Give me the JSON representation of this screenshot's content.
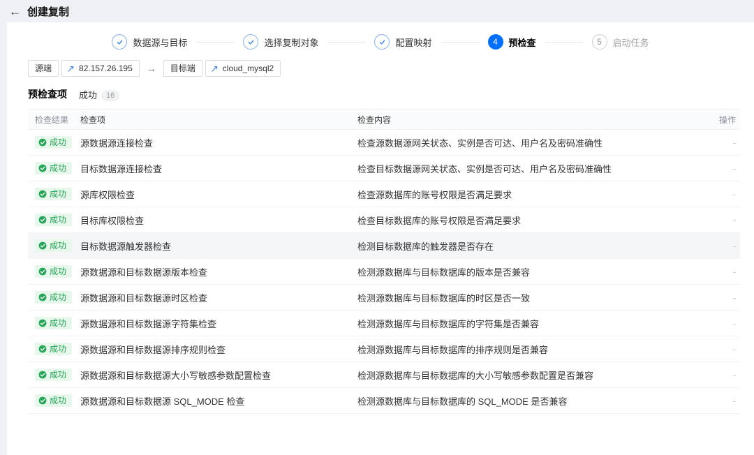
{
  "page": {
    "back_glyph": "←",
    "title": "创建复制"
  },
  "stepper": {
    "steps": [
      {
        "num": "1",
        "label": "数据源与目标",
        "state": "done"
      },
      {
        "num": "2",
        "label": "选择复制对象",
        "state": "done"
      },
      {
        "num": "3",
        "label": "配置映射",
        "state": "done"
      },
      {
        "num": "4",
        "label": "预检查",
        "state": "current"
      },
      {
        "num": "5",
        "label": "启动任务",
        "state": "pending"
      }
    ]
  },
  "endpoints": {
    "source_label": "源端",
    "source_value": "82.157.26.195",
    "arrow": "→",
    "target_label": "目标端",
    "target_value": "cloud_mysql2"
  },
  "precheck": {
    "title": "预检查项",
    "status_text": "成功",
    "count": "16"
  },
  "table": {
    "columns": [
      "检查结果",
      "检查项",
      "检查内容",
      "操作"
    ],
    "success_label": "成功",
    "highlighted_row_index": 4,
    "rows": [
      {
        "item": "源数据源连接检查",
        "content": "检查源数据源网关状态、实例是否可达、用户名及密码准确性",
        "op": "-"
      },
      {
        "item": "目标数据源连接检查",
        "content": "检查目标数据源网关状态、实例是否可达、用户名及密码准确性",
        "op": "-"
      },
      {
        "item": "源库权限检查",
        "content": "检查源数据库的账号权限是否满足要求",
        "op": "-"
      },
      {
        "item": "目标库权限检查",
        "content": "检查目标数据库的账号权限是否满足要求",
        "op": "-"
      },
      {
        "item": "目标数据源触发器检查",
        "content": "检测目标数据库的触发器是否存在",
        "op": "-"
      },
      {
        "item": "源数据源和目标数据源版本检查",
        "content": "检测源数据库与目标数据库的版本是否兼容",
        "op": "-"
      },
      {
        "item": "源数据源和目标数据源时区检查",
        "content": "检测源数据库与目标数据库的时区是否一致",
        "op": "-"
      },
      {
        "item": "源数据源和目标数据源字符集检查",
        "content": "检测源数据库与目标数据库的字符集是否兼容",
        "op": "-"
      },
      {
        "item": "源数据源和目标数据源排序规则检查",
        "content": "检测源数据库与目标数据库的排序规则是否兼容",
        "op": "-"
      },
      {
        "item": "源数据源和目标数据源大小写敏感参数配置检查",
        "content": "检测源数据库与目标数据库的大小写敏感参数配置是否兼容",
        "op": "-"
      },
      {
        "item": "源数据源和目标数据源 SQL_MODE 检查",
        "content": "检测源数据库与目标数据库的 SQL_MODE 是否兼容",
        "op": "-"
      }
    ]
  },
  "colors": {
    "accent_blue": "#006eff",
    "success_green": "#22a454",
    "success_bg": "#e7f7ec",
    "page_bg": "#eef0f4"
  }
}
